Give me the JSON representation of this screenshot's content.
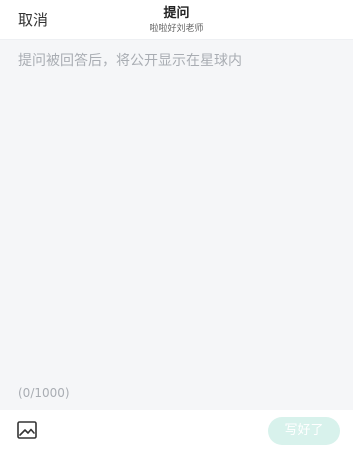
{
  "header": {
    "cancel_label": "取消",
    "title": "提问",
    "subtitle": "啦啦好刘老师"
  },
  "editor": {
    "placeholder": "提问被回答后，将公开显示在星球内",
    "value": "",
    "counter": "(0/1000)"
  },
  "footer": {
    "image_icon": "image-icon",
    "submit_label": "写好了"
  },
  "colors": {
    "editor_bg": "#f5f6f8",
    "submit_bg_disabled": "#d8f2ec",
    "placeholder": "#a9adb3"
  }
}
